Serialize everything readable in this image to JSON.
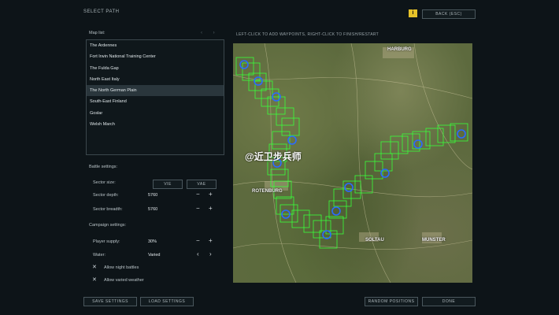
{
  "header": {
    "title": "SELECT PATH",
    "info_label": "i",
    "back_label": "BACK (ESC)"
  },
  "map_list": {
    "label": "Map list:",
    "items": [
      "The Ardennes",
      "Fort Irwin National Training Center",
      "The Fulda Gap",
      "North East Italy",
      "The North German Plain",
      "South-East Finland",
      "Goslar",
      "Welsh March"
    ],
    "selected_index": 4
  },
  "battle_settings": {
    "label": "Battle settings:",
    "sector_size_label": "Sector size:",
    "size_options": [
      "VIE",
      "VAE"
    ],
    "sector_depth_label": "Sector depth:",
    "sector_depth_value": "5760",
    "sector_breadth_label": "Sector breadth:",
    "sector_breadth_value": "5760"
  },
  "campaign_settings": {
    "label": "Campaign settings:",
    "player_supply_label": "Player supply:",
    "player_supply_value": "30%",
    "water_label": "Water:",
    "water_value": "Varied",
    "night_battles_label": "Allow night battles",
    "varied_weather_label": "Allow varied weather"
  },
  "map": {
    "instruction": "LEFT-CLICK TO ADD WAYPOINTS, RIGHT-CLICK TO FINISH/RESTART",
    "watermark": "@近卫步兵师",
    "cities": [
      {
        "name": "HARBURG"
      },
      {
        "name": "ROTENBURG"
      },
      {
        "name": "SOLTAU"
      },
      {
        "name": "MUNSTER"
      }
    ]
  },
  "footer": {
    "save_label": "SAVE SETTINGS",
    "load_label": "LOAD SETTINGS",
    "random_label": "RANDOM POSITIONS",
    "done_label": "DONE"
  },
  "colors": {
    "accent": "#e6c229",
    "path": "#39ff3a",
    "waypoint": "#1f5bff"
  }
}
